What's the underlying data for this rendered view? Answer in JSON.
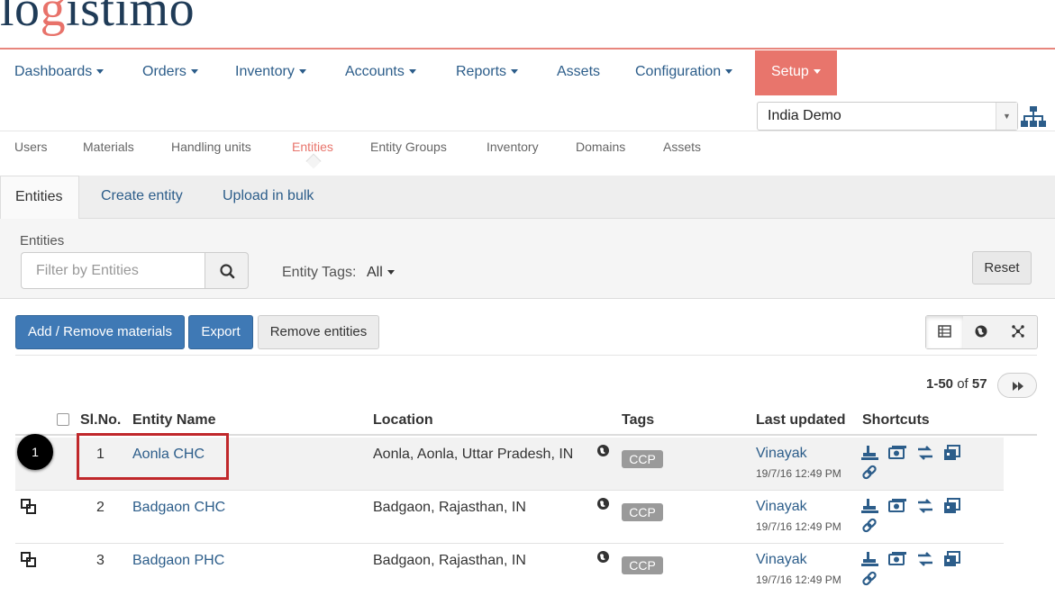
{
  "brand": {
    "logo_main": "logistimo",
    "accent_color": "#e8756c"
  },
  "main_nav": [
    {
      "label": "Dashboards",
      "dropdown": true
    },
    {
      "label": "Orders",
      "dropdown": true
    },
    {
      "label": "Inventory",
      "dropdown": true
    },
    {
      "label": "Accounts",
      "dropdown": true
    },
    {
      "label": "Reports",
      "dropdown": true
    },
    {
      "label": "Assets",
      "dropdown": false
    },
    {
      "label": "Configuration",
      "dropdown": true
    },
    {
      "label": "Setup",
      "dropdown": true,
      "active": true
    }
  ],
  "domain_select": {
    "value": "India Demo"
  },
  "sub_nav": [
    {
      "label": "Users"
    },
    {
      "label": "Materials"
    },
    {
      "label": "Handling units"
    },
    {
      "label": "Entities",
      "active": true
    },
    {
      "label": "Entity Groups"
    },
    {
      "label": "Inventory"
    },
    {
      "label": "Domains"
    },
    {
      "label": "Assets"
    }
  ],
  "tabs": [
    {
      "label": "Entities",
      "active": true
    },
    {
      "label": "Create entity"
    },
    {
      "label": "Upload in bulk"
    }
  ],
  "filters": {
    "entities_label": "Entities",
    "entities_placeholder": "Filter by Entities",
    "tags_label": "Entity Tags:",
    "tags_value": "All",
    "reset_label": "Reset"
  },
  "actions": {
    "add_remove_materials": "Add / Remove materials",
    "export": "Export",
    "remove_entities": "Remove entities"
  },
  "pagination": {
    "range": "1-50",
    "of_word": "of",
    "total": "57"
  },
  "table": {
    "headers": {
      "slno": "Sl.No.",
      "name": "Entity Name",
      "location": "Location",
      "tags": "Tags",
      "last_updated": "Last updated",
      "shortcuts": "Shortcuts"
    },
    "rows": [
      {
        "slno": "1",
        "name": "Aonla CHC",
        "location": "Aonla, Aonla, Uttar Pradesh, IN",
        "tag": "CCP",
        "updated_by": "Vinayak",
        "updated_at": "19/7/16 12:49 PM"
      },
      {
        "slno": "2",
        "name": "Badgaon CHC",
        "location": "Badgaon, Rajasthan, IN",
        "tag": "CCP",
        "updated_by": "Vinayak",
        "updated_at": "19/7/16 12:49 PM"
      },
      {
        "slno": "3",
        "name": "Badgaon PHC",
        "location": "Badgaon, Rajasthan, IN",
        "tag": "CCP",
        "updated_by": "Vinayak",
        "updated_at": "19/7/16 12:49 PM"
      }
    ]
  },
  "annotation": {
    "step": "1",
    "color": "#c0282b"
  },
  "icons": [
    "search-icon",
    "hierarchy-icon",
    "table-view-icon",
    "map-view-icon",
    "network-view-icon",
    "fast-forward-icon",
    "globe-icon",
    "inventory-icon",
    "orders-icon",
    "transfer-icon",
    "stock-icon",
    "link-icon",
    "relationship-icon"
  ]
}
